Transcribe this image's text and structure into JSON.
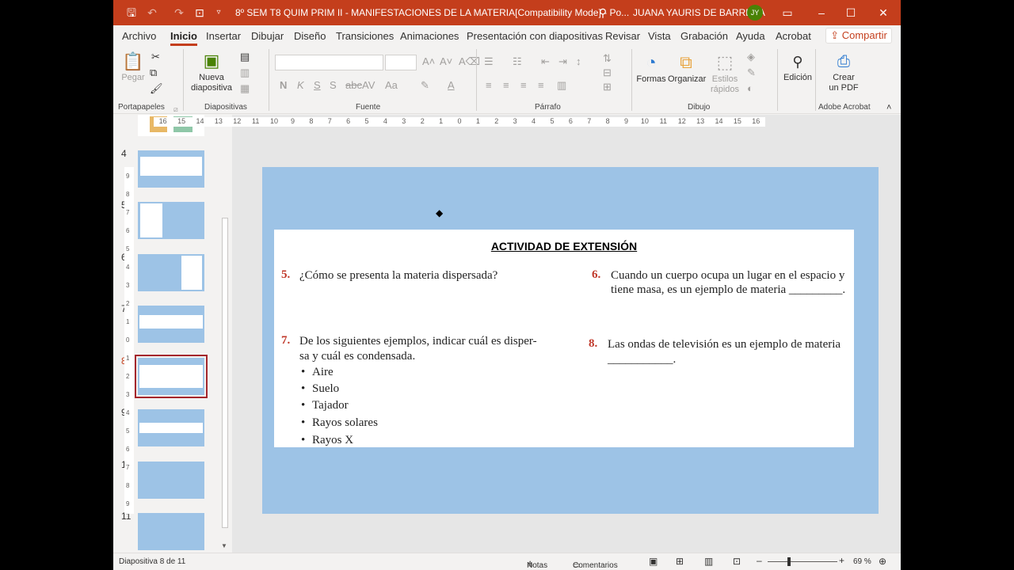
{
  "titlebar": {
    "title": "8º SEM T8 QUIM PRIM II - MANIFESTACIONES DE LA MATERIA[Compatibility Mode]  -  Po...",
    "user": "JUANA YAURIS DE BARRERA",
    "avatar_initials": "JY"
  },
  "menu": {
    "tabs": [
      "Archivo",
      "Inicio",
      "Insertar",
      "Dibujar",
      "Diseño",
      "Transiciones",
      "Animaciones",
      "Presentación con diapositivas",
      "Revisar",
      "Vista",
      "Grabación",
      "Ayuda",
      "Acrobat"
    ],
    "share": "Compartir"
  },
  "ribbon": {
    "paste": "Pegar",
    "new_slide_1": "Nueva",
    "new_slide_2": "diapositiva",
    "shapes": "Formas",
    "arrange": "Organizar",
    "styles_1": "Estilos",
    "styles_2": "rápidos",
    "editing": "Edición",
    "create_pdf_1": "Crear",
    "create_pdf_2": "un PDF",
    "groups": {
      "clipboard": "Portapapeles",
      "slides": "Diapositivas",
      "font": "Fuente",
      "paragraph": "Párrafo",
      "drawing": "Dibujo",
      "acrobat": "Adobe Acrobat"
    }
  },
  "thumbs": [
    "4",
    "5",
    "6",
    "7",
    "8",
    "9",
    "10",
    "11"
  ],
  "ruler": {
    "h": [
      "16",
      "15",
      "14",
      "13",
      "12",
      "11",
      "10",
      "9",
      "8",
      "7",
      "6",
      "5",
      "4",
      "3",
      "2",
      "1",
      "0",
      "1",
      "2",
      "3",
      "4",
      "5",
      "6",
      "7",
      "8",
      "9",
      "10",
      "11",
      "12",
      "13",
      "14",
      "15",
      "16"
    ],
    "v": [
      "9",
      "8",
      "7",
      "6",
      "5",
      "4",
      "3",
      "2",
      "1",
      "0",
      "1",
      "2",
      "3",
      "4",
      "5",
      "6",
      "7",
      "8",
      "9"
    ]
  },
  "slide": {
    "heading": "ACTIVIDAD DE EXTENSIÓN",
    "q5_num": "5.",
    "q5": "¿Cómo se presenta la materia dispersada?",
    "q6_num": "6.",
    "q6_l1": "Cuando un cuerpo ocupa un lugar en el espacio y",
    "q6_l2": "tiene masa, es un ejemplo de materia _________.",
    "q7_num": "7.",
    "q7_l1": "De los siguientes ejemplos, indicar cuál es disper-",
    "q7_l2": "sa y cuál es condensada.",
    "q7_items": [
      "Aire",
      "Suelo",
      "Tajador",
      "Rayos solares",
      "Rayos X"
    ],
    "q8_num": "8.",
    "q8_l1": "Las ondas de televisión es un ejemplo de materia",
    "q8_l2": "___________."
  },
  "status": {
    "slide_info": "Diapositiva 8 de 11",
    "notes": "Notas",
    "comments": "Comentarios",
    "zoom": "69 %"
  },
  "colors": {
    "accent": "#c43e1c",
    "slide_bg": "#9dc3e6",
    "number_red": "#c0392b"
  }
}
